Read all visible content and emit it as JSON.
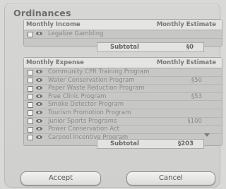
{
  "dialog": {
    "title": "Ordinances"
  },
  "income": {
    "header_left": "Monthly Income",
    "header_right": "Monthly Estimate",
    "items": [
      {
        "name": "Legalize Gambling",
        "amount": ""
      }
    ],
    "subtotal_label": "Subtotal",
    "subtotal_value": "§0"
  },
  "expense": {
    "header_left": "Monthly Expense",
    "header_right": "Monthly Estimate",
    "items": [
      {
        "name": "Community CPR Training Program",
        "amount": ""
      },
      {
        "name": "Water Conservation Program",
        "amount": "§50"
      },
      {
        "name": "Paper Waste Reduction Program",
        "amount": ""
      },
      {
        "name": "Free Clinic Program",
        "amount": "§53"
      },
      {
        "name": "Smoke Detector Program",
        "amount": ""
      },
      {
        "name": "Tourism Promotion Program",
        "amount": ""
      },
      {
        "name": "Junior Sports Programs",
        "amount": "§100"
      },
      {
        "name": "Power Conservation Act",
        "amount": ""
      },
      {
        "name": "Carpool Incentive Program",
        "amount": ""
      }
    ],
    "subtotal_label": "Subtotal",
    "subtotal_value": "§203"
  },
  "buttons": {
    "accept": "Accept",
    "cancel": "Cancel"
  },
  "icons": {
    "checkbox": "checkbox-icon",
    "eye": "eye-icon",
    "scroll": "scroll-down-arrow-icon"
  }
}
